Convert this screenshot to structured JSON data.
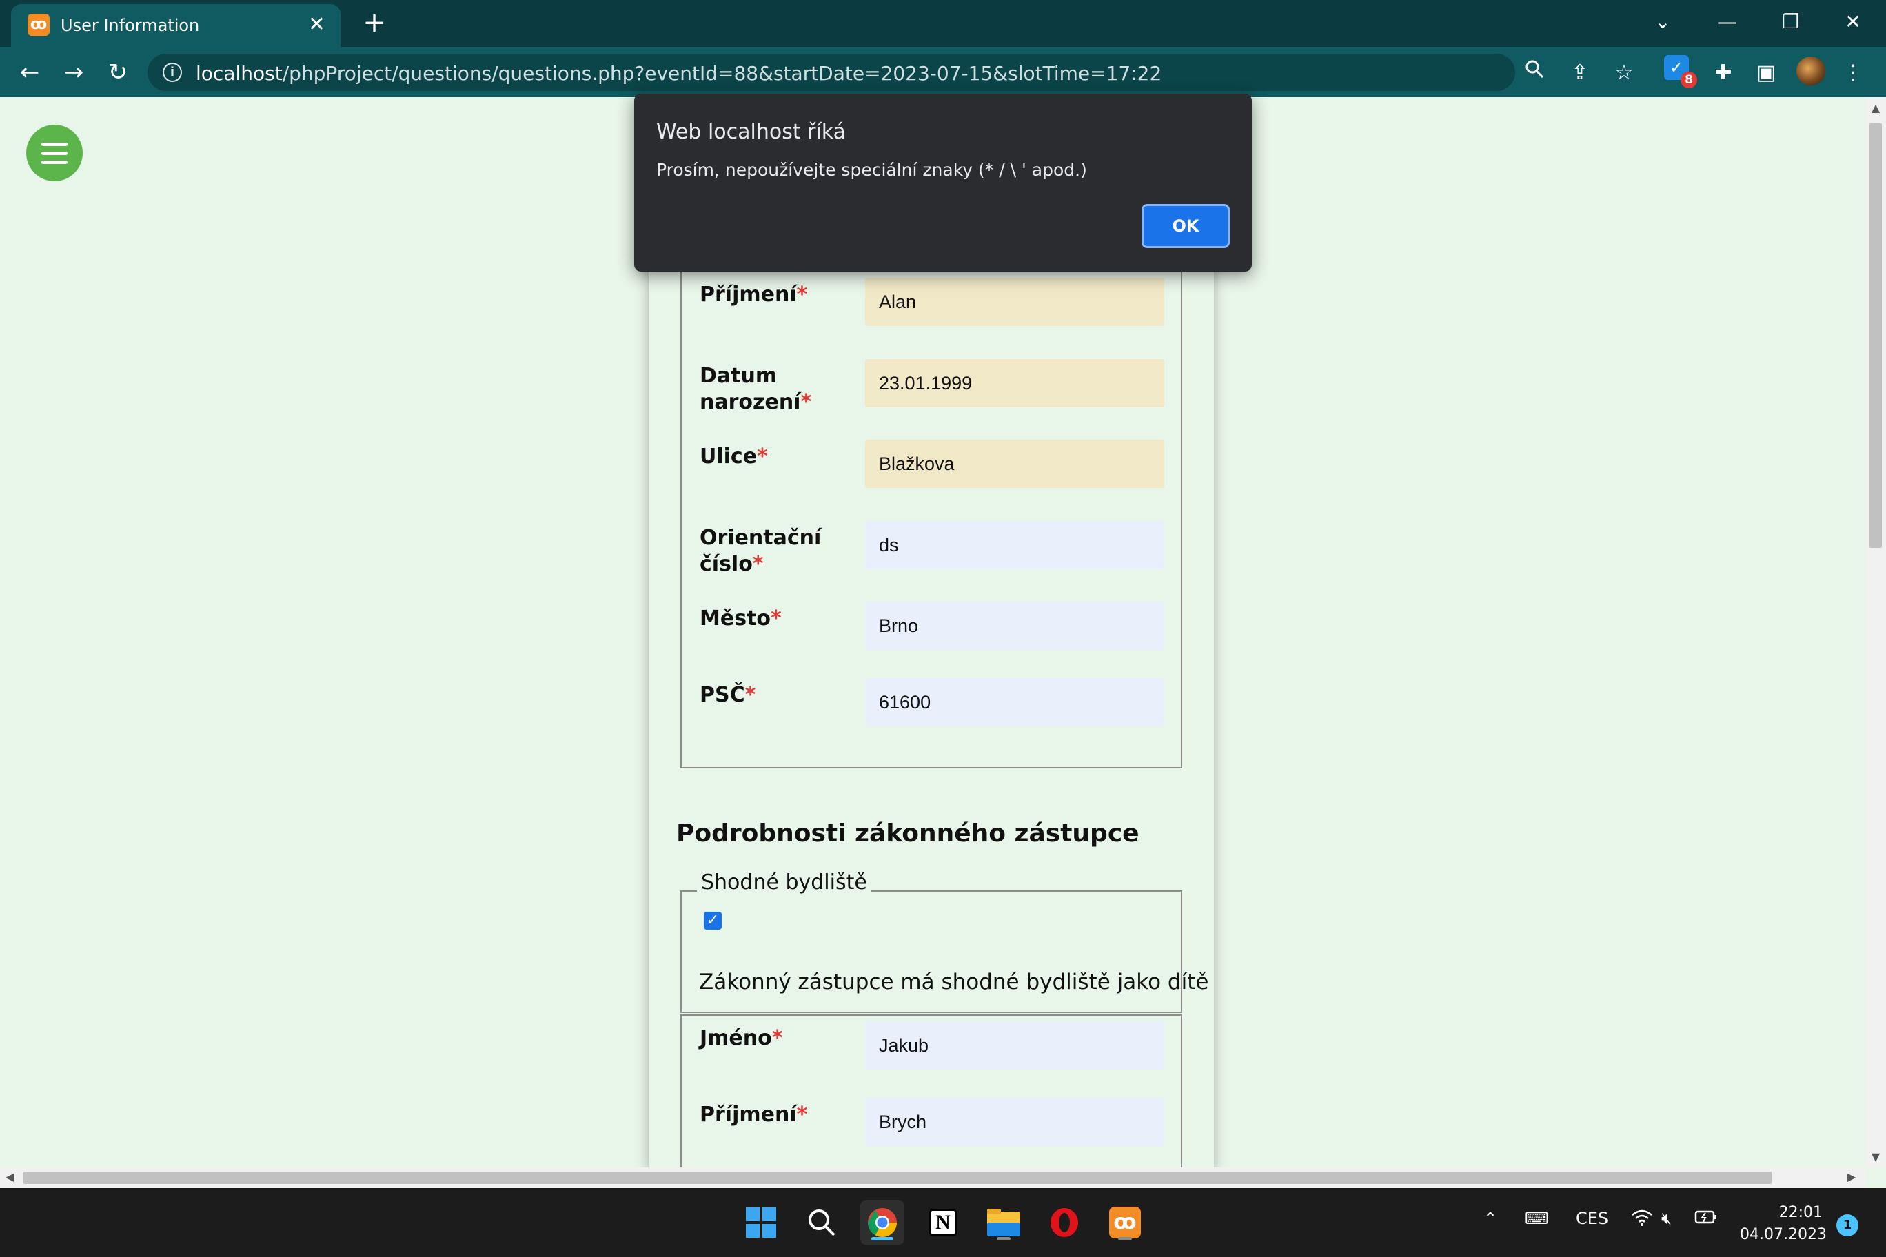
{
  "browser": {
    "tab_title": "User Information",
    "tab_close": "✕",
    "new_tab": "+",
    "window_controls": {
      "dropdown": "⌄",
      "minimize": "—",
      "restore": "❐",
      "close": "✕"
    },
    "url_host": "localhost",
    "url_path": "/phpProject/questions/questions.php?eventId=88&startDate=2023-07-15&slotTime=17:22",
    "extension_count": "8"
  },
  "dialog": {
    "title": "Web localhost říká",
    "message": "Prosím, nepoužívejte speciální znaky (* / \\ ' apod.)",
    "ok_label": "OK"
  },
  "child_form": {
    "fields": [
      {
        "label": "Příjmení",
        "value": "Alan"
      },
      {
        "label_line1": "Datum",
        "label_line2": "narození",
        "value": "23.01.1999"
      },
      {
        "label": "Ulice",
        "value": "Blažkova"
      },
      {
        "label_line1": "Orientační",
        "label_line2": "číslo",
        "value": "ds"
      },
      {
        "label": "Město",
        "value": "Brno"
      },
      {
        "label": "PSČ",
        "value": "61600"
      }
    ],
    "required_mark": "*"
  },
  "guardian": {
    "section_title": "Podrobnosti zákonného zástupce",
    "same_address_legend": "Shodné bydliště",
    "same_address_checked": true,
    "same_address_text": "Zákonný zástupce má shodné bydliště jako dítě",
    "fields": [
      {
        "label": "Jméno",
        "value": "Jakub"
      },
      {
        "label": "Příjmení",
        "value": "Brych"
      }
    ]
  },
  "taskbar": {
    "language": "CES",
    "time": "22:01",
    "date": "04.07.2023",
    "notification_count": "1"
  },
  "colors": {
    "page_background": "#e8f5e9",
    "validated_input": "#f0e8c6",
    "default_input": "#e9f0fb",
    "required_star": "#e53935",
    "menu_button": "#5cb54a",
    "dialog_ok": "#1a73e8"
  }
}
